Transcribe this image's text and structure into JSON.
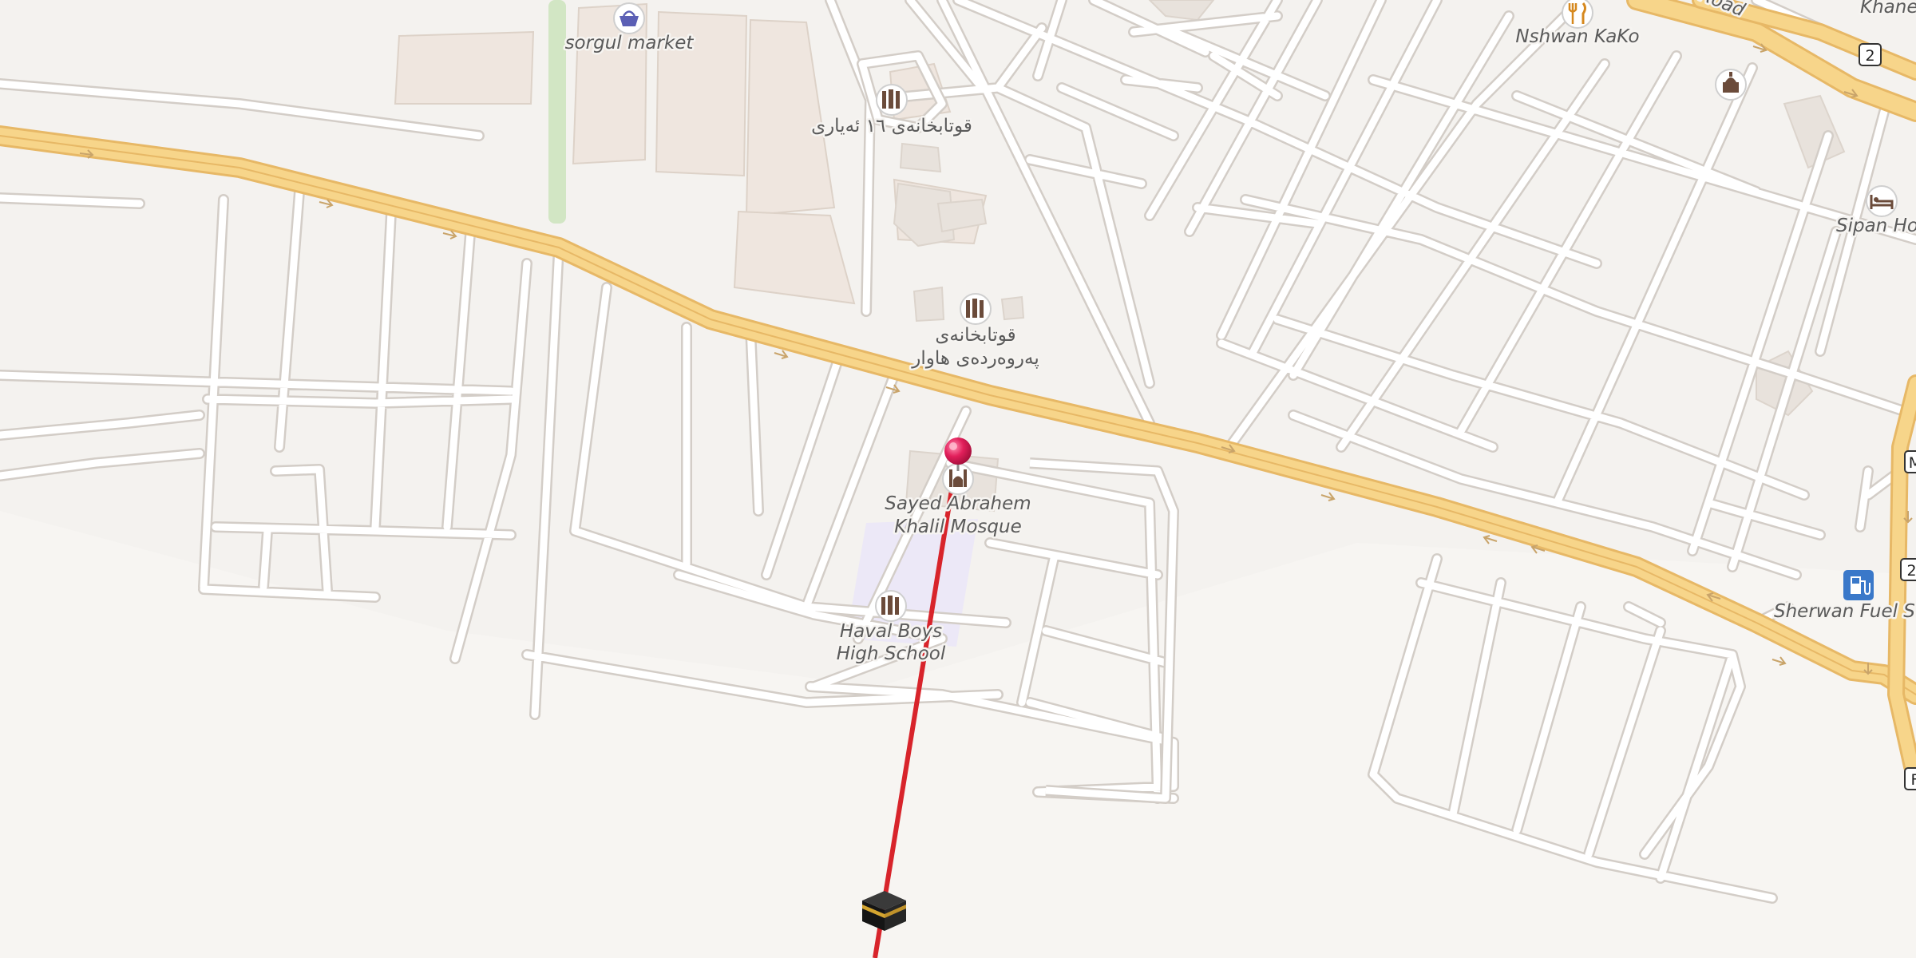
{
  "map": {
    "pois": {
      "sorgul_market": "sorgul market",
      "nshwan_kako": "Nshwan KaKo",
      "school_ku_1": "قوتابخانەی ١٦ ئەیاری",
      "school_ku_2_line1": "قوتابخانەی",
      "school_ku_2_line2": "پەروەردەی هاوار",
      "mosque_line1": "Sayed Abrahem",
      "mosque_line2": "Khalil Mosque",
      "school_line1": "Haval Boys",
      "school_line2": "High School",
      "hotel": "Sipan Hot",
      "fuel": "Sherwan Fuel Stat",
      "khane": "Khane",
      "road": "Road"
    },
    "road_shields": [
      "2",
      "2"
    ],
    "edge_shields": [
      "M",
      "F"
    ],
    "icons": {
      "market": "shopping-basket-icon",
      "restaurant": "fork-knife-icon",
      "school": "school-icon",
      "mosque": "mosque-icon",
      "hotel": "bed-icon",
      "fuel": "fuel-pump-icon",
      "kaaba": "kaaba-icon",
      "pin": "location-pin-icon"
    },
    "colors": {
      "background": "#f4f2ef",
      "minor_road": "#ffffff",
      "major_road": "#f7d58a",
      "major_road_edge": "#e7b866",
      "qibla_line": "#d8242b",
      "pin": "#e0205a",
      "fuel_badge": "#3a78c9"
    }
  }
}
